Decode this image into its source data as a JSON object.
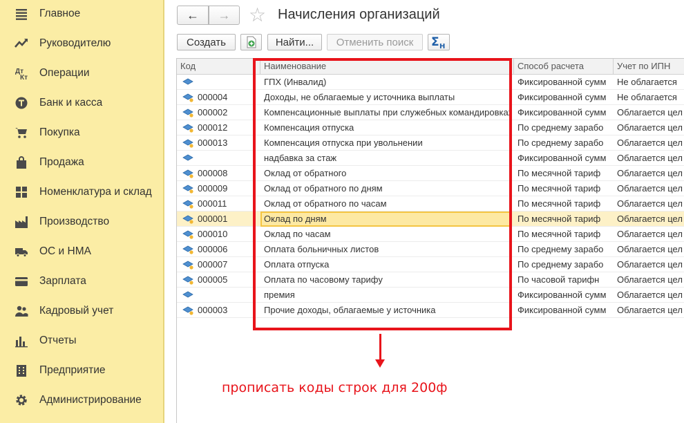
{
  "sidebar": {
    "items": [
      {
        "label": "Главное",
        "icon": "menu-lines-icon"
      },
      {
        "label": "Руководителю",
        "icon": "trend-line-icon"
      },
      {
        "label": "Операции",
        "icon": "dt-kt-icon"
      },
      {
        "label": "Банк и касса",
        "icon": "coin-icon"
      },
      {
        "label": "Покупка",
        "icon": "cart-icon"
      },
      {
        "label": "Продажа",
        "icon": "bag-icon"
      },
      {
        "label": "Номенклатура и склад",
        "icon": "grid-blocks-icon"
      },
      {
        "label": "Производство",
        "icon": "factory-icon"
      },
      {
        "label": "ОС и НМА",
        "icon": "truck-icon"
      },
      {
        "label": "Зарплата",
        "icon": "card-icon"
      },
      {
        "label": "Кадровый учет",
        "icon": "people-icon"
      },
      {
        "label": "Отчеты",
        "icon": "bar-chart-icon"
      },
      {
        "label": "Предприятие",
        "icon": "building-icon"
      },
      {
        "label": "Администрирование",
        "icon": "gear-icon"
      }
    ]
  },
  "header": {
    "title": "Начисления организаций",
    "back": "←",
    "forward": "→",
    "star": "☆"
  },
  "toolbar": {
    "create": "Создать",
    "find": "Найти...",
    "cancel_search": "Отменить поиск"
  },
  "table": {
    "columns": [
      "Код",
      "Наименование",
      "Способ расчета",
      "Учет по ИПН"
    ],
    "rows": [
      {
        "code": "",
        "name": "ГПХ (Инвалид)",
        "method": "Фиксированной сумм",
        "ipn": "Не облагается"
      },
      {
        "code": "000004",
        "name": "Доходы, не облагаемые у источника выплаты",
        "method": "Фиксированной сумм",
        "ipn": "Не облагается"
      },
      {
        "code": "000002",
        "name": "Компенсационные выплаты при служебных командировках",
        "method": "Фиксированной сумм",
        "ipn": "Облагается цел"
      },
      {
        "code": "000012",
        "name": "Компенсация отпуска",
        "method": "По среднему зарабо",
        "ipn": "Облагается цел"
      },
      {
        "code": "000013",
        "name": "Компенсация отпуска при увольнении",
        "method": "По среднему зарабо",
        "ipn": "Облагается цел"
      },
      {
        "code": "",
        "name": "надбавка за стаж",
        "method": "Фиксированной сумм",
        "ipn": "Облагается цел"
      },
      {
        "code": "000008",
        "name": "Оклад от обратного",
        "method": "По месячной тариф",
        "ipn": "Облагается цел"
      },
      {
        "code": "000009",
        "name": "Оклад от обратного по дням",
        "method": "По месячной тариф",
        "ipn": "Облагается цел"
      },
      {
        "code": "000011",
        "name": "Оклад от обратного по часам",
        "method": "По месячной тариф",
        "ipn": "Облагается цел"
      },
      {
        "code": "000001",
        "name": "Оклад по дням",
        "method": "По месячной тариф",
        "ipn": "Облагается цел"
      },
      {
        "code": "000010",
        "name": "Оклад по часам",
        "method": "По месячной тариф",
        "ipn": "Облагается цел"
      },
      {
        "code": "000006",
        "name": "Оплата больничных листов",
        "method": "По среднему зарабо",
        "ipn": "Облагается цел"
      },
      {
        "code": "000007",
        "name": "Оплата отпуска",
        "method": "По среднему зарабо",
        "ipn": "Облагается цел"
      },
      {
        "code": "000005",
        "name": "Оплата по часовому тарифу",
        "method": "По часовой тарифн",
        "ipn": "Облагается цел"
      },
      {
        "code": "",
        "name": "премия",
        "method": "Фиксированной сумм",
        "ipn": "Облагается цел"
      },
      {
        "code": "000003",
        "name": "Прочие доходы, облагаемые у источника",
        "method": "Фиксированной сумм",
        "ipn": "Облагается цел"
      }
    ],
    "selected_index": 9
  },
  "annotation": {
    "text": "прописать коды строк для 200ф",
    "color": "#e8141b"
  }
}
